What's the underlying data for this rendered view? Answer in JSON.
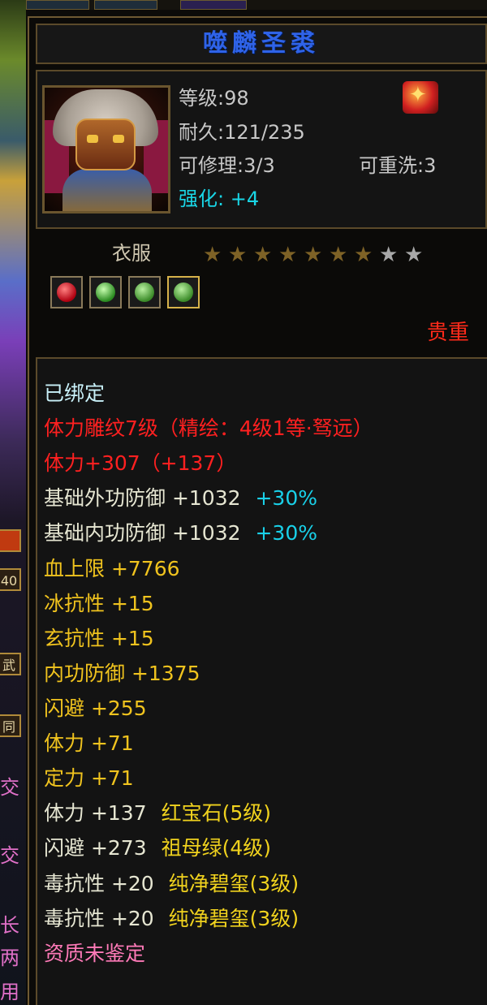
{
  "item": {
    "name": "噬麟圣裘",
    "level": "等级:98",
    "durability": "耐久:121/235",
    "repair": "可修理:3/3",
    "rewash": "可重洗:3",
    "enhance": "强化: +4",
    "type": "衣服",
    "stars": {
      "filled": 7,
      "total": 9
    },
    "rarity": "贵重"
  },
  "properties": {
    "bound": "已绑定",
    "engrave": "体力雕纹7级（精绘：4级1等·驽远）",
    "vit_total": "体力+307（+137）",
    "ext_def": {
      "label": "基础外功防御 +1032",
      "bonus": "+30%"
    },
    "int_def": {
      "label": "基础内功防御 +1032",
      "bonus": "+30%"
    },
    "hp": "血上限 +7766",
    "ice_res": "冰抗性 +15",
    "mystic_res": "玄抗性 +15",
    "inner_def": "内功防御 +1375",
    "dodge": "闪避 +255",
    "vit": "体力 +71",
    "focus": "定力 +71",
    "gem1": {
      "stat": "体力 +137",
      "gem": "红宝石(5级)"
    },
    "gem2": {
      "stat": "闪避 +273",
      "gem": "祖母绿(4级)"
    },
    "gem3": {
      "stat": "毒抗性 +20",
      "gem": "纯净碧玺(3级)"
    },
    "gem4": {
      "stat": "毒抗性 +20",
      "gem": "纯净碧玺(3级)"
    },
    "aptitude": "资质未鉴定"
  },
  "sidebar": {
    "count": "40",
    "tab1": "武",
    "tab2": "同",
    "tab3": "交",
    "tab4": "交",
    "tab5": "长",
    "tab6": "两",
    "tab7": "用"
  },
  "colors": {
    "title": "#2f63e8",
    "red": "#ff2020",
    "yellow": "#f0c31e",
    "cyan": "#19d0e8",
    "pink": "#ff7ab8"
  },
  "icons": [
    "item-portrait-icon",
    "fire-emblem-icon",
    "ruby-gem-icon",
    "emerald-gem-icon",
    "star-icon"
  ]
}
